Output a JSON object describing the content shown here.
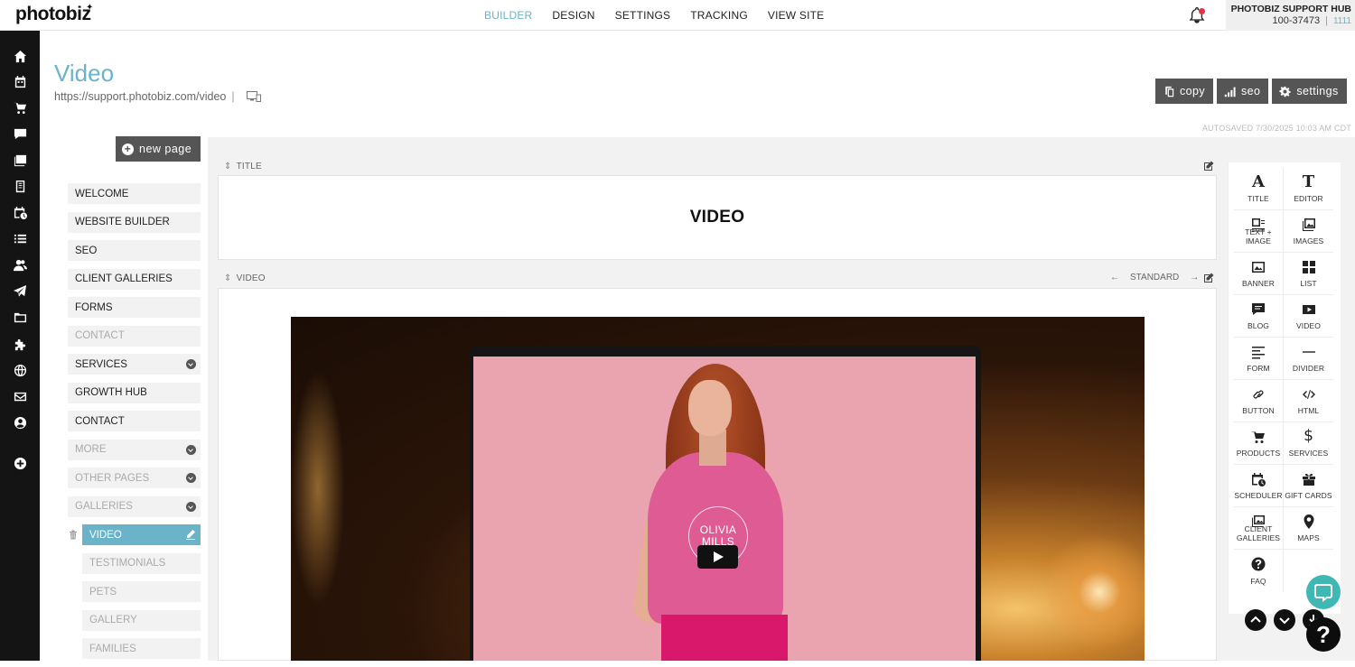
{
  "brand": {
    "logo_text": "photobiz"
  },
  "topnav": {
    "items": [
      {
        "label": "BUILDER",
        "active": true
      },
      {
        "label": "DESIGN",
        "active": false
      },
      {
        "label": "SETTINGS",
        "active": false
      },
      {
        "label": "TRACKING",
        "active": false
      },
      {
        "label": "VIEW SITE",
        "active": false
      }
    ]
  },
  "account": {
    "name": "PHOTOBIZ SUPPORT HUB",
    "number": "100-37473",
    "code": "1111"
  },
  "rail": {
    "icons": [
      "home-icon",
      "calendar-icon",
      "cart-icon",
      "chat-icon",
      "gallery-icon",
      "document-icon",
      "scheduler-icon",
      "list-icon",
      "contacts-icon",
      "send-icon",
      "folder-icon",
      "puzzle-icon",
      "globe-icon",
      "mail-icon",
      "user-icon",
      "add-icon"
    ]
  },
  "page": {
    "title": "Video",
    "url": "https://support.photobiz.com/video",
    "pipe": "|",
    "autosaved": "AUTOSAVED 7/30/2025 10:03 AM CDT"
  },
  "header_buttons": {
    "copy": "copy",
    "seo": "seo",
    "settings": "settings"
  },
  "new_page_label": "new page",
  "pages": [
    {
      "label": "WELCOME"
    },
    {
      "label": "WEBSITE BUILDER"
    },
    {
      "label": "SEO"
    },
    {
      "label": "CLIENT GALLERIES"
    },
    {
      "label": "FORMS"
    },
    {
      "label": "CONTACT"
    },
    {
      "label": "SERVICES"
    },
    {
      "label": "GROWTH HUB"
    },
    {
      "label": "CONTACT"
    },
    {
      "label": "MORE"
    },
    {
      "label": "OTHER PAGES"
    },
    {
      "label": "GALLERIES"
    },
    {
      "label": "VIDEO"
    },
    {
      "label": "TESTIMONIALS"
    },
    {
      "label": "PETS"
    },
    {
      "label": "GALLERY"
    },
    {
      "label": "FAMILIES"
    }
  ],
  "sections": {
    "title_label": "TITLE",
    "title_heading": "VIDEO",
    "video_label": "VIDEO",
    "video_layout": "STANDARD",
    "video_overlay_text": "OLIVIA MILLS"
  },
  "widgets": [
    {
      "label": "TITLE",
      "icon": "title-icon"
    },
    {
      "label": "EDITOR",
      "icon": "editor-icon"
    },
    {
      "label": "TEXT + IMAGE",
      "icon": "text-image-icon"
    },
    {
      "label": "IMAGES",
      "icon": "images-icon"
    },
    {
      "label": "BANNER",
      "icon": "banner-icon"
    },
    {
      "label": "LIST",
      "icon": "list-icon"
    },
    {
      "label": "BLOG",
      "icon": "blog-icon"
    },
    {
      "label": "VIDEO",
      "icon": "video-icon"
    },
    {
      "label": "FORM",
      "icon": "form-icon"
    },
    {
      "label": "DIVIDER",
      "icon": "divider-icon"
    },
    {
      "label": "BUTTON",
      "icon": "link-icon"
    },
    {
      "label": "HTML",
      "icon": "code-icon"
    },
    {
      "label": "PRODUCTS",
      "icon": "cart-icon"
    },
    {
      "label": "SERVICES",
      "icon": "dollar-icon"
    },
    {
      "label": "SCHEDULER",
      "icon": "scheduler-icon"
    },
    {
      "label": "GIFT CARDS",
      "icon": "gift-icon"
    },
    {
      "label": "CLIENT GALLERIES",
      "icon": "client-galleries-icon"
    },
    {
      "label": "MAPS",
      "icon": "map-pin-icon"
    },
    {
      "label": "FAQ",
      "icon": "question-icon"
    }
  ],
  "help": {
    "glyph": "?"
  },
  "colors": {
    "accent": "#6bb3c9",
    "rail": "#141414",
    "button": "#555555",
    "chat": "#3fb7b4"
  }
}
